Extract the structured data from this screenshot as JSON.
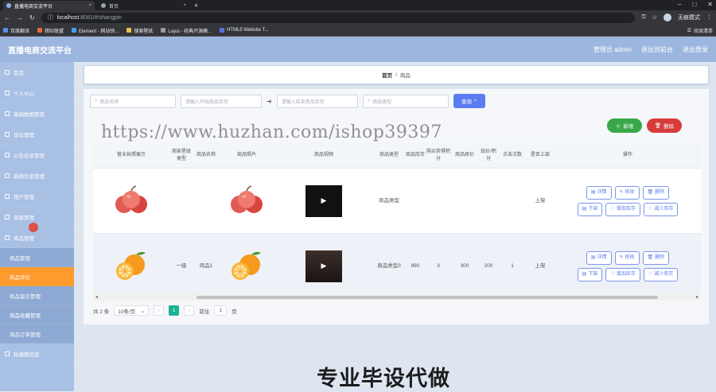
{
  "browser": {
    "tabs": [
      {
        "label": "直播电商交流平台",
        "close": "×"
      },
      {
        "label": "首页",
        "close": "×"
      }
    ],
    "new_tab": "+",
    "url_host": "localhost",
    "url_rest": ":8081/#/shangpin",
    "incognito_label": "无痕模式",
    "bookmarks": [
      "百度翻译",
      "猎际联盟",
      "Element - 网站快...",
      "搜索壁纸",
      "Layui - 经典开源模...",
      "HTML5 Website T..."
    ],
    "reading_list": "阅读清单"
  },
  "header": {
    "title": "直播电商交流平台",
    "user_label": "管理员 admin",
    "exit_backend": "退出到前台",
    "logout": "退出登录"
  },
  "sidebar": {
    "items": [
      {
        "label": "首页",
        "type": "top"
      },
      {
        "label": "个人中心",
        "type": "top"
      },
      {
        "label": "基础数据管理",
        "type": "top"
      },
      {
        "label": "论坛管理",
        "type": "top"
      },
      {
        "label": "公告信息管理",
        "type": "top"
      },
      {
        "label": "新闻信息管理",
        "type": "top"
      },
      {
        "label": "用户管理",
        "type": "top"
      },
      {
        "label": "商家管理",
        "type": "top"
      },
      {
        "label": "商品管理",
        "type": "top"
      },
      {
        "label": "商品管理",
        "type": "sub"
      },
      {
        "label": "商品评论",
        "type": "sub",
        "active": true
      },
      {
        "label": "商品留言管理",
        "type": "sub"
      },
      {
        "label": "商品收藏管理",
        "type": "sub"
      },
      {
        "label": "商品订单管理",
        "type": "sub"
      },
      {
        "label": "轮播图信息",
        "type": "top"
      }
    ]
  },
  "breadcrumb": {
    "home": "首页",
    "sep": "/",
    "current": "商品"
  },
  "search": {
    "name_placeholder": "商品名称",
    "start_placeholder": "请输入开始商品库存",
    "end_placeholder": "请输入结束商品库存",
    "type_placeholder": "商品类型",
    "search_label": "查询"
  },
  "actions": {
    "add_label": "新增",
    "delete_label": "删除"
  },
  "table": {
    "headers": [
      "营业执照展示",
      "商家星级类型",
      "商品名称",
      "商品照片",
      "商品视频",
      "商品类型",
      "商品库存",
      "购买获得积分",
      "商品原价",
      "现价/积分",
      "点击次数",
      "是否上架",
      "操作"
    ],
    "rows": [
      {
        "star": "",
        "name": "",
        "type": "商品类型",
        "stock": "",
        "points": "",
        "price": "",
        "now": "",
        "clicks": "",
        "onsale": "上架",
        "fruit": "apple"
      },
      {
        "star": "一级",
        "name": "商品1",
        "type": "商品类型3",
        "stock": "990",
        "points": "3",
        "price": "300",
        "now": "200",
        "clicks": "1",
        "onsale": "上架",
        "fruit": "orange"
      }
    ],
    "ops": [
      "详情",
      "修改",
      "删除",
      "下架",
      "增加库存",
      "减少库存"
    ]
  },
  "pager": {
    "total": "共 2 条",
    "page_size": "10条/页",
    "current": "1",
    "goto": "前往",
    "goto_value": "1",
    "page_unit": "页"
  },
  "overlay": {
    "watermark": "https://www.huzhan.com/ishop39397",
    "caption": "专业毕设代做"
  },
  "colors": {
    "header": "#9db6df",
    "sidebar": "#a8c0e4",
    "active": "#ff9b2d",
    "primary": "#5b7cf2",
    "add": "#39a84a",
    "delete": "#d83b3b",
    "pager_active": "#19b394"
  }
}
